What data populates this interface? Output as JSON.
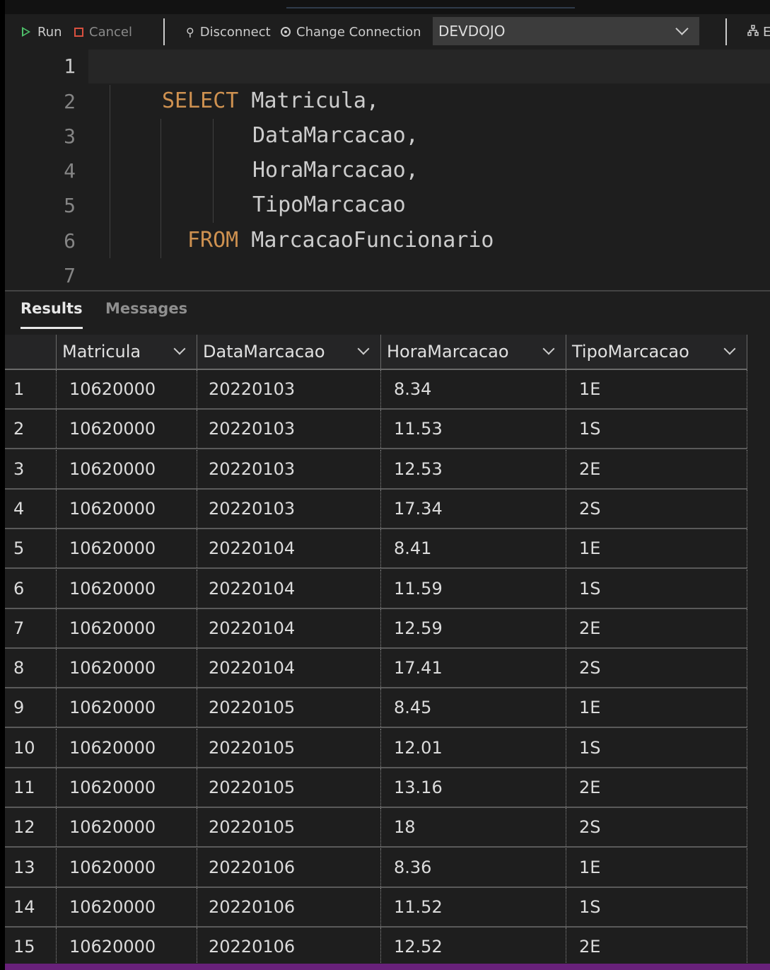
{
  "toolbar": {
    "run_label": "Run",
    "cancel_label": "Cancel",
    "disconnect_label": "Disconnect",
    "change_connection_label": "Change Connection",
    "connection_value": "DEVDOJO",
    "explain_label": "E"
  },
  "editor": {
    "line_numbers": [
      "1",
      "2",
      "3",
      "4",
      "5",
      "6",
      "7"
    ],
    "lines": [
      {
        "kw": "",
        "text": ""
      },
      {
        "kw": "SELECT",
        "text": " Matricula,"
      },
      {
        "kw": "",
        "text": "DataMarcacao,"
      },
      {
        "kw": "",
        "text": "HoraMarcacao,"
      },
      {
        "kw": "",
        "text": "TipoMarcacao"
      },
      {
        "kw": "FROM",
        "text": " MarcacaoFuncionario"
      },
      {
        "kw": "",
        "text": ""
      }
    ]
  },
  "results": {
    "tabs": [
      "Results",
      "Messages"
    ],
    "columns": [
      "Matricula",
      "DataMarcacao",
      "HoraMarcacao",
      "TipoMarcacao"
    ],
    "rows": [
      [
        "1",
        "10620000",
        "20220103",
        "8.34",
        "1E"
      ],
      [
        "2",
        "10620000",
        "20220103",
        "11.53",
        "1S"
      ],
      [
        "3",
        "10620000",
        "20220103",
        "12.53",
        "2E"
      ],
      [
        "4",
        "10620000",
        "20220103",
        "17.34",
        "2S"
      ],
      [
        "5",
        "10620000",
        "20220104",
        "8.41",
        "1E"
      ],
      [
        "6",
        "10620000",
        "20220104",
        "11.59",
        "1S"
      ],
      [
        "7",
        "10620000",
        "20220104",
        "12.59",
        "2E"
      ],
      [
        "8",
        "10620000",
        "20220104",
        "17.41",
        "2S"
      ],
      [
        "9",
        "10620000",
        "20220105",
        "8.45",
        "1E"
      ],
      [
        "10",
        "10620000",
        "20220105",
        "12.01",
        "1S"
      ],
      [
        "11",
        "10620000",
        "20220105",
        "13.16",
        "2E"
      ],
      [
        "12",
        "10620000",
        "20220105",
        "18",
        "2S"
      ],
      [
        "13",
        "10620000",
        "20220106",
        "8.36",
        "1E"
      ],
      [
        "14",
        "10620000",
        "20220106",
        "11.52",
        "1S"
      ],
      [
        "15",
        "10620000",
        "20220106",
        "12.52",
        "2E"
      ]
    ]
  },
  "colors": {
    "run_icon": "#4ec16a",
    "cancel_icon": "#d9503f",
    "keyword": "#ce9150",
    "status_bar": "#68217a"
  }
}
